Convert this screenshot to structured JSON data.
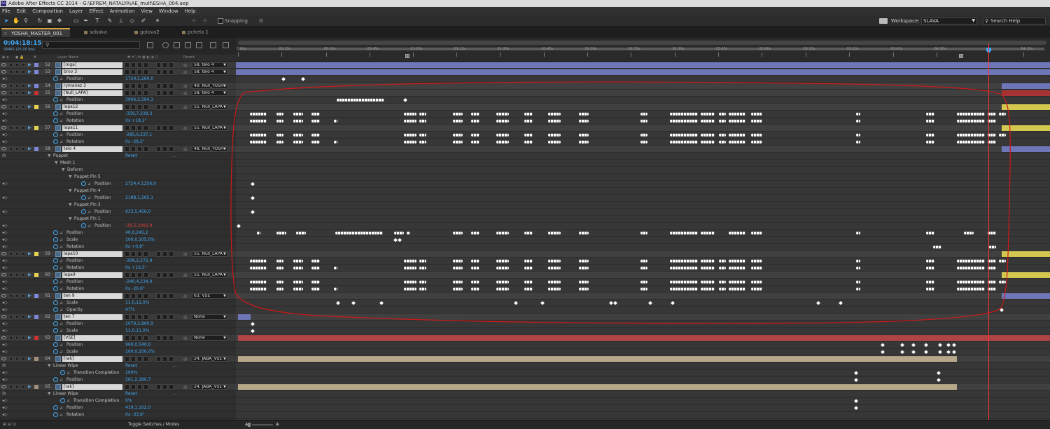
{
  "app": {
    "title": "Adobe After Effects CC 2014 - G:\\EFREM_NATALYA\\AE_mult\\ESHA_004.aep"
  },
  "menu": [
    "File",
    "Edit",
    "Composition",
    "Layer",
    "Effect",
    "Animation",
    "View",
    "Window",
    "Help"
  ],
  "toolbar": {
    "snapping_label": "Snapping",
    "workspace_label": "Workspace:",
    "workspace_value": "SLAVA",
    "search_placeholder": "Search Help"
  },
  "tabs": [
    "YOSHA_MASTER_001",
    "sobaka",
    "golova2",
    "pchela 1"
  ],
  "timeline": {
    "timecode": "0:04:18:15",
    "fps": "06465 (25.00 fps)",
    "columns": {
      "layer_name": "Layer Name",
      "parent": "Parent"
    },
    "ruler": [
      "0:00s",
      "00:15s",
      "00:30s",
      "00:45s",
      "01:00s",
      "01:15s",
      "01:30s",
      "01:45s",
      "02:00s",
      "02:15s",
      "02:30s",
      "02:45s",
      "03:00s",
      "03:15s",
      "03:30s",
      "03:45s",
      "04:00s",
      "04:30s"
    ],
    "markers": [
      "1",
      "2"
    ],
    "toggle_label": "Toggle Switches / Modes"
  },
  "rows": [
    {
      "kind": "layer",
      "num": "52",
      "name": "[roga]",
      "label_color": "#7d87d6",
      "parent": "58. telo 4"
    },
    {
      "kind": "layer",
      "num": "53",
      "name": "brov 3",
      "label_color": "#7d87d6",
      "parent": "58. telo 4"
    },
    {
      "kind": "prop",
      "indent": 1,
      "name": "Position",
      "value": "1724,5,260,0"
    },
    {
      "kind": "layer",
      "num": "54",
      "name": "rymanez 3",
      "label_color": "#7d87d6",
      "parent": "49. Null_YOSH"
    },
    {
      "kind": "layer",
      "num": "55",
      "name": "[Null_LAPA]",
      "label_color": "#c83232",
      "parent": "58. telo 4"
    },
    {
      "kind": "prop",
      "indent": 1,
      "name": "Position",
      "value": "3906,2,564,3"
    },
    {
      "kind": "layer",
      "num": "56",
      "name": "lapa12",
      "label_color": "#e2d24e",
      "parent": "55. Null_LAPA"
    },
    {
      "kind": "prop",
      "indent": 1,
      "name": "Position",
      "value": "-359,7,239,3"
    },
    {
      "kind": "prop",
      "indent": 1,
      "name": "Rotation",
      "value": "0x +18,1°"
    },
    {
      "kind": "layer",
      "num": "57",
      "name": "lapa11",
      "label_color": "#e2d24e",
      "parent": "55. Null_LAPA"
    },
    {
      "kind": "prop",
      "indent": 1,
      "name": "Position",
      "value": "-285,6,237,1"
    },
    {
      "kind": "prop",
      "indent": 1,
      "name": "Rotation",
      "value": "0x -28,2°"
    },
    {
      "kind": "layer",
      "num": "58",
      "name": "telo 4",
      "label_color": "#7d87d6",
      "parent": "48. Null_YOSH"
    },
    {
      "kind": "group",
      "indent": 1,
      "name": "Puppet",
      "value": "Reset",
      "extra": "..."
    },
    {
      "kind": "group",
      "indent": 2,
      "name": "Mesh 1"
    },
    {
      "kind": "group",
      "indent": 3,
      "name": "Deform"
    },
    {
      "kind": "group",
      "indent": 4,
      "name": "Puppet Pin 5"
    },
    {
      "kind": "prop",
      "indent": 5,
      "name": "Position",
      "value": "2724,4,1256,0"
    },
    {
      "kind": "group",
      "indent": 4,
      "name": "Puppet Pin 4"
    },
    {
      "kind": "prop",
      "indent": 5,
      "name": "Position",
      "value": "2188,1,265,1"
    },
    {
      "kind": "group",
      "indent": 4,
      "name": "Puppet Pin 3"
    },
    {
      "kind": "prop",
      "indent": 5,
      "name": "Position",
      "value": "633,5,456,0"
    },
    {
      "kind": "group",
      "indent": 4,
      "name": "Puppet Pin 1"
    },
    {
      "kind": "prop",
      "indent": 5,
      "name": "Position",
      "value": "-36,5,2092,9",
      "red": true
    },
    {
      "kind": "prop",
      "indent": 1,
      "name": "Position",
      "value": "40,0,245,2"
    },
    {
      "kind": "prop",
      "indent": 1,
      "name": "Scale",
      "value": "100,0,105,0%"
    },
    {
      "kind": "prop",
      "indent": 1,
      "name": "Rotation",
      "value": "0x +0,8°"
    },
    {
      "kind": "layer",
      "num": "59",
      "name": "lapa10",
      "label_color": "#e2d24e",
      "parent": "55. Null_LAPA"
    },
    {
      "kind": "prop",
      "indent": 1,
      "name": "Position",
      "value": "-308,2,272,9"
    },
    {
      "kind": "prop",
      "indent": 1,
      "name": "Rotation",
      "value": "0x +16,5°"
    },
    {
      "kind": "layer",
      "num": "60",
      "name": "lapa9",
      "label_color": "#e2d24e",
      "parent": "55. Null_LAPA"
    },
    {
      "kind": "prop",
      "indent": 1,
      "name": "Position",
      "value": "-240,4,234,0"
    },
    {
      "kind": "prop",
      "indent": 1,
      "name": "Rotation",
      "value": "0x -26,6°"
    },
    {
      "kind": "layer",
      "num": "61",
      "name": "ten 9",
      "label_color": "#7d87d6",
      "parent": "63. VSE"
    },
    {
      "kind": "prop",
      "indent": 1,
      "name": "Scale",
      "value": "11,0,11,0%"
    },
    {
      "kind": "prop",
      "indent": 1,
      "name": "Opacity",
      "value": "47%"
    },
    {
      "kind": "layer",
      "num": "62",
      "name": "ten 7",
      "label_color": "#7d87d6",
      "parent": "None"
    },
    {
      "kind": "prop",
      "indent": 1,
      "name": "Position",
      "value": "1079,2,860,9"
    },
    {
      "kind": "prop",
      "indent": 1,
      "name": "Scale",
      "value": "11,0,11,0%"
    },
    {
      "kind": "layer",
      "num": "63",
      "name": "[VSE]",
      "label_color": "#c83232",
      "parent": "None"
    },
    {
      "kind": "prop",
      "indent": 1,
      "name": "Position",
      "value": "960,0,540,0"
    },
    {
      "kind": "prop",
      "indent": 1,
      "name": "Scale",
      "value": "100,0,100,0%"
    },
    {
      "kind": "layer",
      "num": "64",
      "name": "[rak]",
      "label_color": "#a3907a",
      "parent": "24. JABA_VSE"
    },
    {
      "kind": "group",
      "indent": 1,
      "name": "Linear Wipe",
      "value": "Reset",
      "extra": "..."
    },
    {
      "kind": "prop",
      "indent": 2,
      "name": "Transition Completion",
      "value": "100%"
    },
    {
      "kind": "prop",
      "indent": 1,
      "name": "Position",
      "value": "261,2,180,7"
    },
    {
      "kind": "layer",
      "num": "65",
      "name": "[rak]",
      "label_color": "#a3907a",
      "parent": "24. JABA_VSE"
    },
    {
      "kind": "group",
      "indent": 1,
      "name": "Linear Wipe",
      "value": "Reset",
      "extra": "..."
    },
    {
      "kind": "prop",
      "indent": 2,
      "name": "Transition Completion",
      "value": "0%"
    },
    {
      "kind": "prop",
      "indent": 1,
      "name": "Position",
      "value": "419,1,102,0"
    },
    {
      "kind": "prop",
      "indent": 1,
      "name": "Rotation",
      "value": "0x -33,8°"
    }
  ],
  "colors": {
    "accent": "#3fa9f5",
    "cti": "#ff3333",
    "annotation": "#d01818"
  }
}
